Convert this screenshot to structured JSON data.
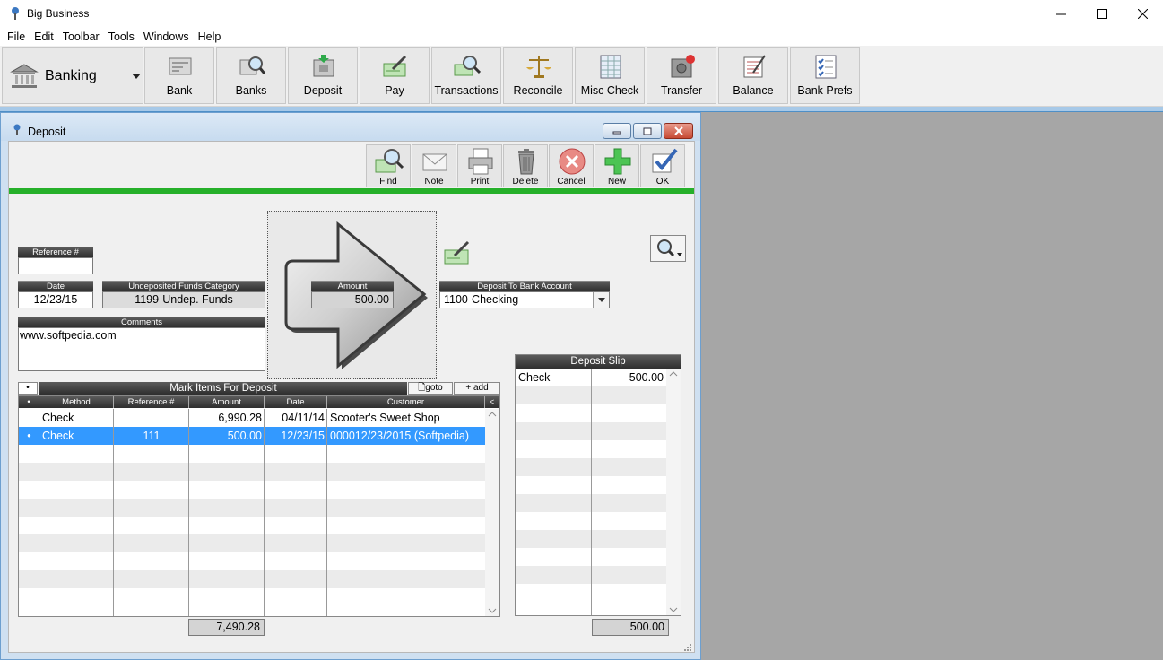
{
  "app": {
    "title": "Big Business"
  },
  "menu": [
    "File",
    "Edit",
    "Toolbar",
    "Tools",
    "Windows",
    "Help"
  ],
  "toolbar": {
    "module": "Banking",
    "buttons": [
      {
        "label": "Bank",
        "icon": "bank-icon"
      },
      {
        "label": "Banks",
        "icon": "banks-search-icon"
      },
      {
        "label": "Deposit",
        "icon": "deposit-icon"
      },
      {
        "label": "Pay",
        "icon": "pay-icon"
      },
      {
        "label": "Transactions",
        "icon": "transactions-icon"
      },
      {
        "label": "Reconcile",
        "icon": "scales-icon"
      },
      {
        "label": "Misc Check",
        "icon": "misc-check-icon"
      },
      {
        "label": "Transfer",
        "icon": "transfer-icon"
      },
      {
        "label": "Balance",
        "icon": "balance-icon"
      },
      {
        "label": "Bank Prefs",
        "icon": "checklist-icon"
      }
    ]
  },
  "deposit": {
    "title": "Deposit",
    "actions": [
      {
        "label": "Find",
        "icon": "find-icon"
      },
      {
        "label": "Note",
        "icon": "note-icon"
      },
      {
        "label": "Print",
        "icon": "print-icon"
      },
      {
        "label": "Delete",
        "icon": "trash-icon"
      },
      {
        "label": "Cancel",
        "icon": "cancel-icon"
      },
      {
        "label": "New",
        "icon": "plus-icon"
      },
      {
        "label": "OK",
        "icon": "ok-icon"
      }
    ],
    "fields": {
      "reference_label": "Reference #",
      "reference_value": "",
      "date_label": "Date",
      "date_value": "12/23/15",
      "undeposited_label": "Undeposited Funds Category",
      "undeposited_value": "1199-Undep. Funds",
      "comments_label": "Comments",
      "comments_value": "www.softpedia.com",
      "amount_label": "Amount",
      "amount_value": "500.00",
      "bank_account_label": "Deposit To Bank Account",
      "bank_account_value": "1100-Checking"
    },
    "mark_items": {
      "title": "Mark Items For Deposit",
      "goto_label": "goto",
      "add_label": "+ add",
      "bullet": "•",
      "columns": [
        "•",
        "Method",
        "Reference #",
        "Amount",
        "Date",
        "Customer"
      ],
      "collapse_label": "<",
      "rows": [
        {
          "mark": "",
          "method": "Check",
          "reference": "",
          "amount": "6,990.28",
          "date": "04/11/14",
          "customer": "Scooter's Sweet Shop",
          "selected": false
        },
        {
          "mark": "•",
          "method": "Check",
          "reference": "111",
          "amount": "500.00",
          "date": "12/23/15",
          "customer": "000012/23/2015 (Softpedia)",
          "selected": true
        }
      ],
      "total": "7,490.28"
    },
    "deposit_slip": {
      "title": "Deposit Slip",
      "rows": [
        {
          "method": "Check",
          "amount": "500.00"
        }
      ],
      "total": "500.00"
    }
  },
  "colors": {
    "selection": "#3399ff",
    "green_bar": "#26b02a",
    "workspace": "#a6a6a6"
  }
}
